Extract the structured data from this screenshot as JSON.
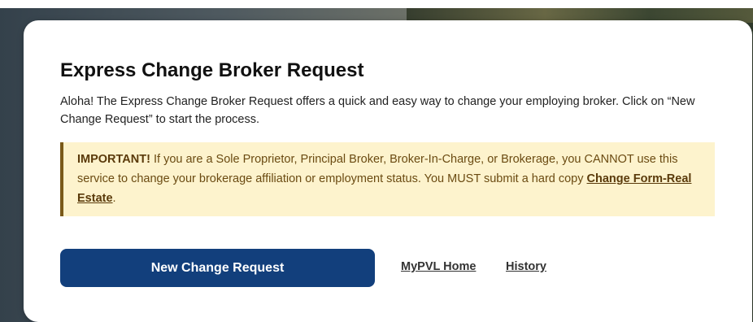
{
  "modal": {
    "title": "Express Change Broker Request",
    "intro": "Aloha! The Express Change Broker Request offers a quick and easy way to change your employing broker. Click on “New Change Request” to start the process.",
    "notice": {
      "strong": "IMPORTANT!",
      "text": " If you are a Sole Proprietor, Principal Broker, Broker-In-Charge, or Brokerage, you CANNOT use this service to change your brokerage affiliation or employment status. You MUST submit a hard copy ",
      "link_label": "Change Form-Real Estate",
      "suffix": "."
    },
    "actions": {
      "primary_label": "New Change Request",
      "home_link": "MyPVL Home",
      "history_link": "History"
    }
  },
  "colors": {
    "primary": "#123f7c",
    "notice_bg": "#fdf3cd",
    "notice_border": "#7a5a1a",
    "notice_text": "#6b4b12"
  }
}
